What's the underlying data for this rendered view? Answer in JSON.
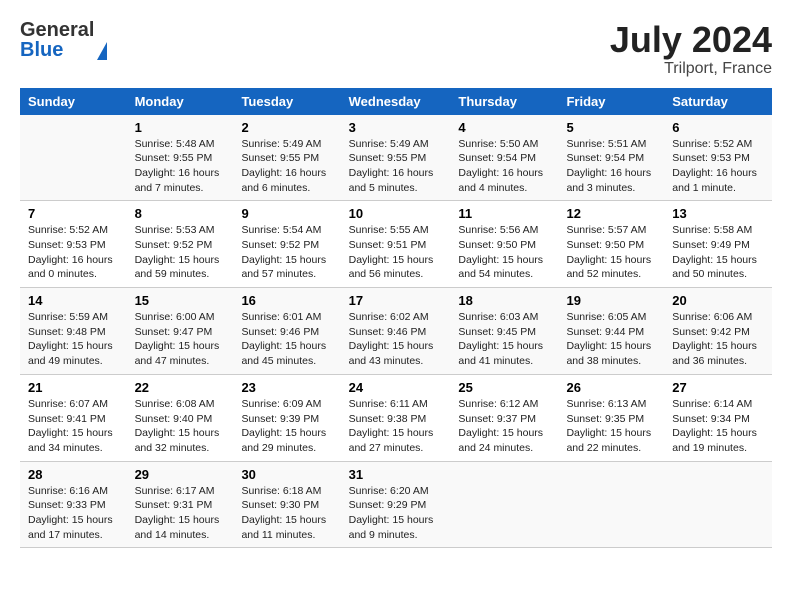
{
  "header": {
    "logo_general": "General",
    "logo_blue": "Blue",
    "month_year": "July 2024",
    "location": "Trilport, France"
  },
  "calendar": {
    "days_of_week": [
      "Sunday",
      "Monday",
      "Tuesday",
      "Wednesday",
      "Thursday",
      "Friday",
      "Saturday"
    ],
    "weeks": [
      [
        {
          "day": "",
          "info": ""
        },
        {
          "day": "1",
          "info": "Sunrise: 5:48 AM\nSunset: 9:55 PM\nDaylight: 16 hours\nand 7 minutes."
        },
        {
          "day": "2",
          "info": "Sunrise: 5:49 AM\nSunset: 9:55 PM\nDaylight: 16 hours\nand 6 minutes."
        },
        {
          "day": "3",
          "info": "Sunrise: 5:49 AM\nSunset: 9:55 PM\nDaylight: 16 hours\nand 5 minutes."
        },
        {
          "day": "4",
          "info": "Sunrise: 5:50 AM\nSunset: 9:54 PM\nDaylight: 16 hours\nand 4 minutes."
        },
        {
          "day": "5",
          "info": "Sunrise: 5:51 AM\nSunset: 9:54 PM\nDaylight: 16 hours\nand 3 minutes."
        },
        {
          "day": "6",
          "info": "Sunrise: 5:52 AM\nSunset: 9:53 PM\nDaylight: 16 hours\nand 1 minute."
        }
      ],
      [
        {
          "day": "7",
          "info": "Sunrise: 5:52 AM\nSunset: 9:53 PM\nDaylight: 16 hours\nand 0 minutes."
        },
        {
          "day": "8",
          "info": "Sunrise: 5:53 AM\nSunset: 9:52 PM\nDaylight: 15 hours\nand 59 minutes."
        },
        {
          "day": "9",
          "info": "Sunrise: 5:54 AM\nSunset: 9:52 PM\nDaylight: 15 hours\nand 57 minutes."
        },
        {
          "day": "10",
          "info": "Sunrise: 5:55 AM\nSunset: 9:51 PM\nDaylight: 15 hours\nand 56 minutes."
        },
        {
          "day": "11",
          "info": "Sunrise: 5:56 AM\nSunset: 9:50 PM\nDaylight: 15 hours\nand 54 minutes."
        },
        {
          "day": "12",
          "info": "Sunrise: 5:57 AM\nSunset: 9:50 PM\nDaylight: 15 hours\nand 52 minutes."
        },
        {
          "day": "13",
          "info": "Sunrise: 5:58 AM\nSunset: 9:49 PM\nDaylight: 15 hours\nand 50 minutes."
        }
      ],
      [
        {
          "day": "14",
          "info": "Sunrise: 5:59 AM\nSunset: 9:48 PM\nDaylight: 15 hours\nand 49 minutes."
        },
        {
          "day": "15",
          "info": "Sunrise: 6:00 AM\nSunset: 9:47 PM\nDaylight: 15 hours\nand 47 minutes."
        },
        {
          "day": "16",
          "info": "Sunrise: 6:01 AM\nSunset: 9:46 PM\nDaylight: 15 hours\nand 45 minutes."
        },
        {
          "day": "17",
          "info": "Sunrise: 6:02 AM\nSunset: 9:46 PM\nDaylight: 15 hours\nand 43 minutes."
        },
        {
          "day": "18",
          "info": "Sunrise: 6:03 AM\nSunset: 9:45 PM\nDaylight: 15 hours\nand 41 minutes."
        },
        {
          "day": "19",
          "info": "Sunrise: 6:05 AM\nSunset: 9:44 PM\nDaylight: 15 hours\nand 38 minutes."
        },
        {
          "day": "20",
          "info": "Sunrise: 6:06 AM\nSunset: 9:42 PM\nDaylight: 15 hours\nand 36 minutes."
        }
      ],
      [
        {
          "day": "21",
          "info": "Sunrise: 6:07 AM\nSunset: 9:41 PM\nDaylight: 15 hours\nand 34 minutes."
        },
        {
          "day": "22",
          "info": "Sunrise: 6:08 AM\nSunset: 9:40 PM\nDaylight: 15 hours\nand 32 minutes."
        },
        {
          "day": "23",
          "info": "Sunrise: 6:09 AM\nSunset: 9:39 PM\nDaylight: 15 hours\nand 29 minutes."
        },
        {
          "day": "24",
          "info": "Sunrise: 6:11 AM\nSunset: 9:38 PM\nDaylight: 15 hours\nand 27 minutes."
        },
        {
          "day": "25",
          "info": "Sunrise: 6:12 AM\nSunset: 9:37 PM\nDaylight: 15 hours\nand 24 minutes."
        },
        {
          "day": "26",
          "info": "Sunrise: 6:13 AM\nSunset: 9:35 PM\nDaylight: 15 hours\nand 22 minutes."
        },
        {
          "day": "27",
          "info": "Sunrise: 6:14 AM\nSunset: 9:34 PM\nDaylight: 15 hours\nand 19 minutes."
        }
      ],
      [
        {
          "day": "28",
          "info": "Sunrise: 6:16 AM\nSunset: 9:33 PM\nDaylight: 15 hours\nand 17 minutes."
        },
        {
          "day": "29",
          "info": "Sunrise: 6:17 AM\nSunset: 9:31 PM\nDaylight: 15 hours\nand 14 minutes."
        },
        {
          "day": "30",
          "info": "Sunrise: 6:18 AM\nSunset: 9:30 PM\nDaylight: 15 hours\nand 11 minutes."
        },
        {
          "day": "31",
          "info": "Sunrise: 6:20 AM\nSunset: 9:29 PM\nDaylight: 15 hours\nand 9 minutes."
        },
        {
          "day": "",
          "info": ""
        },
        {
          "day": "",
          "info": ""
        },
        {
          "day": "",
          "info": ""
        }
      ]
    ]
  }
}
